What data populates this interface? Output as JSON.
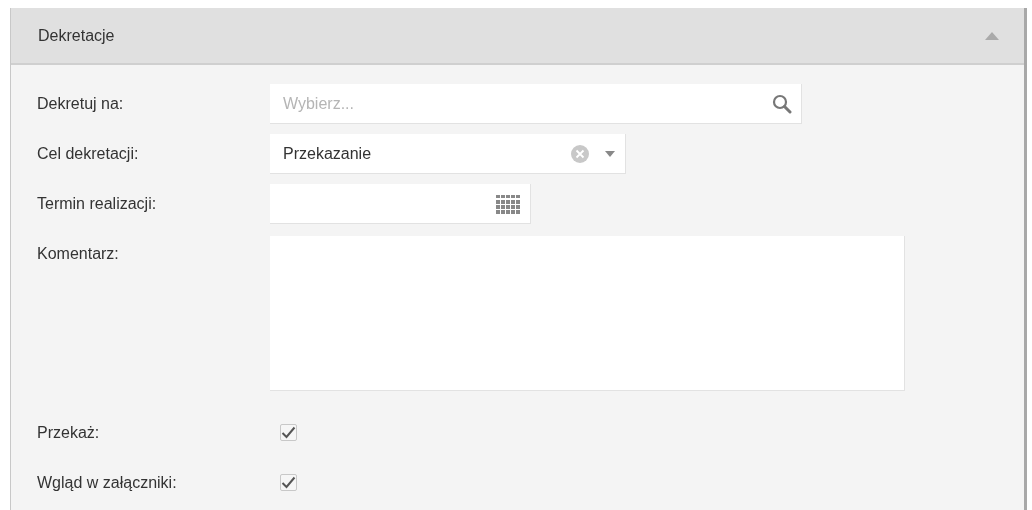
{
  "panel": {
    "title": "Dekretacje",
    "expanded": true
  },
  "fields": [
    {
      "kind": "search",
      "label": "Dekretuj na:",
      "placeholder": "Wybierz..."
    },
    {
      "kind": "select",
      "label": "Cel dekretacji:",
      "value": "Przekazanie"
    },
    {
      "kind": "date",
      "label": "Termin realizacji:"
    },
    {
      "kind": "textarea",
      "label": "Komentarz:"
    },
    {
      "kind": "checkbox",
      "label": "Przekaż:",
      "checked": true
    },
    {
      "kind": "checkbox",
      "label": "Wgląd w załączniki:",
      "checked": true
    }
  ]
}
